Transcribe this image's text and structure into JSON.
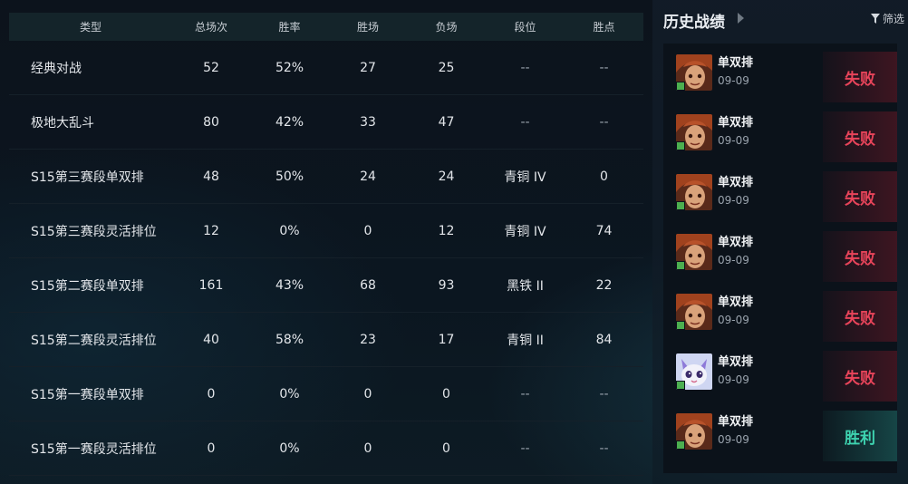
{
  "stats_table": {
    "headers": [
      "类型",
      "总场次",
      "胜率",
      "胜场",
      "负场",
      "段位",
      "胜点"
    ],
    "rows": [
      [
        "经典对战",
        "52",
        "52%",
        "27",
        "25",
        "--",
        "--"
      ],
      [
        "极地大乱斗",
        "80",
        "42%",
        "33",
        "47",
        "--",
        "--"
      ],
      [
        "S15第三赛段单双排",
        "48",
        "50%",
        "24",
        "24",
        "青铜 IV",
        "0"
      ],
      [
        "S15第三赛段灵活排位",
        "12",
        "0%",
        "0",
        "12",
        "青铜 IV",
        "74"
      ],
      [
        "S15第二赛段单双排",
        "161",
        "43%",
        "68",
        "93",
        "黑铁 II",
        "22"
      ],
      [
        "S15第二赛段灵活排位",
        "40",
        "58%",
        "23",
        "17",
        "青铜 II",
        "84"
      ],
      [
        "S15第一赛段单双排",
        "0",
        "0%",
        "0",
        "0",
        "--",
        "--"
      ],
      [
        "S15第一赛段灵活排位",
        "0",
        "0%",
        "0",
        "0",
        "--",
        "--"
      ]
    ]
  },
  "history": {
    "title": "历史战绩",
    "filter_label": "筛选",
    "colors": {
      "loss": "#e8445a",
      "win": "#3ed3b0"
    },
    "matches": [
      {
        "mode": "单双排",
        "date": "09-09",
        "result": "失败",
        "outcome": "loss",
        "champion_icon": "champion-portrait-icon"
      },
      {
        "mode": "单双排",
        "date": "09-09",
        "result": "失败",
        "outcome": "loss",
        "champion_icon": "champion-portrait-icon"
      },
      {
        "mode": "单双排",
        "date": "09-09",
        "result": "失败",
        "outcome": "loss",
        "champion_icon": "champion-portrait-icon"
      },
      {
        "mode": "单双排",
        "date": "09-09",
        "result": "失败",
        "outcome": "loss",
        "champion_icon": "champion-portrait-icon"
      },
      {
        "mode": "单双排",
        "date": "09-09",
        "result": "失败",
        "outcome": "loss",
        "champion_icon": "champion-portrait-icon"
      },
      {
        "mode": "单双排",
        "date": "09-09",
        "result": "失败",
        "outcome": "loss",
        "champion_icon": "cat-champion-portrait-icon"
      },
      {
        "mode": "单双排",
        "date": "09-09",
        "result": "胜利",
        "outcome": "win",
        "champion_icon": "champion-portrait-icon"
      }
    ]
  }
}
